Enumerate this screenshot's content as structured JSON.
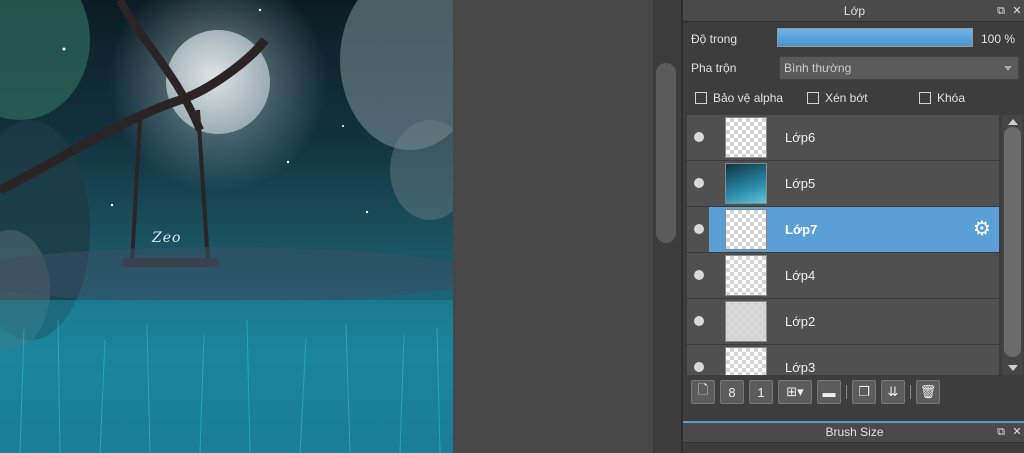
{
  "artwork": {
    "signature": "Zeo"
  },
  "layer_panel": {
    "title": "Lớp",
    "opacity": {
      "label": "Độ trong",
      "value_text": "100 %",
      "value": 100
    },
    "blend": {
      "label": "Pha trộn",
      "selected": "Bình thường"
    },
    "checkboxes": [
      {
        "label": "Bảo vệ alpha",
        "checked": false
      },
      {
        "label": "Xén bớt",
        "checked": false
      },
      {
        "label": "Khóa",
        "checked": false
      }
    ],
    "layers": [
      {
        "name": "Lớp6",
        "visible": true,
        "selected": false
      },
      {
        "name": "Lớp5",
        "visible": true,
        "selected": false
      },
      {
        "name": "Lớp7",
        "visible": true,
        "selected": true
      },
      {
        "name": "Lớp4",
        "visible": true,
        "selected": false
      },
      {
        "name": "Lớp2",
        "visible": true,
        "selected": false
      },
      {
        "name": "Lớp3",
        "visible": true,
        "selected": false
      }
    ],
    "toolbar_icons": [
      "new-layer-icon",
      "new-raster-layer-icon",
      "new-1bit-layer-icon",
      "add-layer-menu-icon",
      "folder-icon",
      "duplicate-icon",
      "merge-down-icon",
      "delete-icon"
    ]
  },
  "brush_panel": {
    "title": "Brush Size"
  },
  "colors": {
    "selected_layer": "#5a9fd6",
    "opacity_bar": "#5ba4e0",
    "accent": "#5b9bd5"
  }
}
